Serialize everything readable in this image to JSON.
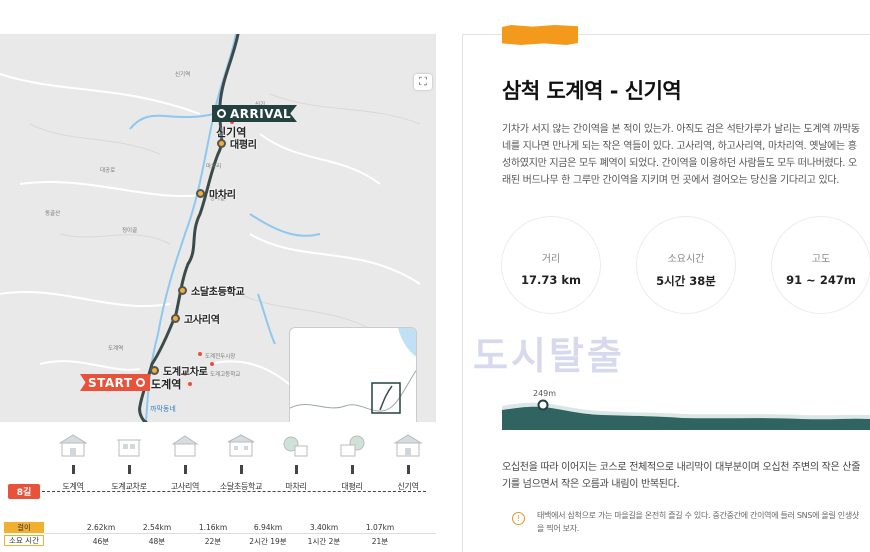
{
  "map": {
    "arrival_label": "ARRIVAL",
    "arrival_station": "신기역",
    "start_label": "START",
    "start_station": "도계역",
    "expand_icon": "expand-icon",
    "stops": [
      {
        "name": "대평리"
      },
      {
        "name": "마차리"
      },
      {
        "name": "소달초등학교"
      },
      {
        "name": "고사리역"
      },
      {
        "name": "도계교차로"
      }
    ],
    "bottom_place": "까막동네"
  },
  "timeline": {
    "badge": "8길",
    "stops": [
      "도계역",
      "도계교차로",
      "고사리역",
      "소달초등학교",
      "마차리",
      "대평리",
      "신기역"
    ],
    "dist_label": "걸이",
    "time_label": "소요 시간",
    "segments": [
      {
        "dist": "2.62km",
        "time": "46분"
      },
      {
        "dist": "2.54km",
        "time": "48분"
      },
      {
        "dist": "1.16km",
        "time": "22분"
      },
      {
        "dist": "6.94km",
        "time": "2시간 19분"
      },
      {
        "dist": "3.40km",
        "time": "1시간 2분"
      },
      {
        "dist": "1.07km",
        "time": "21분"
      }
    ]
  },
  "card": {
    "title": "삼척 도계역 - 신기역",
    "description": "기차가 서지 않는 간이역을 본 적이 있는가. 아직도 검은 석탄가루가 날리는 도계역 까막동네를 지나면 만나게 되는 작은 역들이 있다. 고사리역, 하고사리역, 마차리역. 옛날에는 흥성하였지만 지금은 모두 폐역이 되었다. 간이역을 이용하던 사람들도 모두 떠나버렸다. 오래된 버드나무 한 그루만 간이역을 지키며 먼 곳에서 걸어오는 당신을 기다리고 있다.",
    "stats": [
      {
        "key": "거리",
        "value": "17.73 km"
      },
      {
        "key": "소요시간",
        "value": "5시간 38분"
      },
      {
        "key": "고도",
        "value": "91 ~ 247m"
      }
    ],
    "watermark": "도시탈출",
    "elevation_peak": "249m",
    "summary": "오십천을 따라 이어지는 코스로 전체적으로 내리막이 대부분이며 오십천 주변의 작은 산줄기를 넘으면서 작은 오름과 내림이 반복된다.",
    "note_icon": "!",
    "note": "태백에서 삼척으로 가는 마을길을 온전히 즐길 수 있다. 중간중간에 간이역에 들러 SNS에 올릴 인생샷을 찍어 보자."
  },
  "colors": {
    "accent_orange": "#f39a1d",
    "start_red": "#e8523a",
    "arrival_dark": "#23413f",
    "stop_yellow": "#f0b030",
    "river_blue": "#8ec8ef"
  }
}
